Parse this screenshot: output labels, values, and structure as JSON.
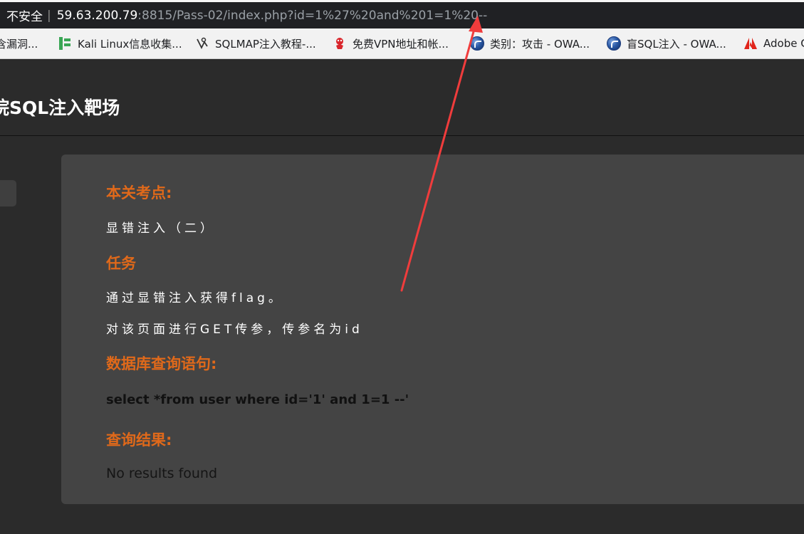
{
  "browser": {
    "security_label": "不安全",
    "url_host": "59.63.200.79",
    "url_rest": ":8815/Pass-02/index.php?id=1%27%20and%201=1%20--"
  },
  "bookmarks": [
    {
      "label": "含漏洞...",
      "icon": "none"
    },
    {
      "label": "Kali Linux信息收集...",
      "icon": "kali-icon"
    },
    {
      "label": "SQLMAP注入教程-...",
      "icon": "sqlmap-icon"
    },
    {
      "label": "免费VPN地址和帐...",
      "icon": "vpn-icon"
    },
    {
      "label": "类别：攻击 - OWA...",
      "icon": "owasp-icon"
    },
    {
      "label": "盲SQL注入 - OWA...",
      "icon": "owasp-icon"
    },
    {
      "label": "Adobe C",
      "icon": "adobe-icon"
    }
  ],
  "site": {
    "title": "院SQL注入靶场"
  },
  "panel": {
    "section1_heading": "本关考点:",
    "section1_text": "显错注入（二）",
    "section2_heading": "任务",
    "task_line1": "通过显错注入获得flag。",
    "task_line2": "对该页面进行GET传参，传参名为id",
    "section3_heading": "数据库查询语句:",
    "query": "select *from user where id='1' and 1=1 --'",
    "section4_heading": "查询结果:",
    "result": "No results found"
  },
  "colors": {
    "accent": "#e0691a",
    "panel_bg": "#444444",
    "page_bg": "#2b2b2b",
    "annotation_arrow": "#f03c3c"
  }
}
